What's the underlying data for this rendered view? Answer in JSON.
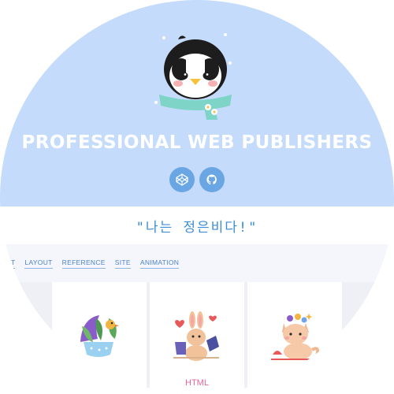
{
  "hero": {
    "title": "PROFESSIONAL WEB PUBLISHERS",
    "background_color": "#c4dbfb",
    "mascot_icon": "penguin-with-scarf-icon",
    "links": [
      {
        "name": "codepen-link",
        "icon": "codepen-icon"
      },
      {
        "name": "github-link",
        "icon": "github-icon"
      }
    ]
  },
  "quote": "\"나는 정은비다!\"",
  "nav": {
    "items": [
      "PT",
      "LAYOUT",
      "REFERENCE",
      "SITE",
      "ANIMATION"
    ]
  },
  "cards": [
    {
      "icon": "plant-bird-illustration-icon",
      "label": ""
    },
    {
      "icon": "bunny-illustration-icon",
      "label": "HTML"
    },
    {
      "icon": "cat-illustration-icon",
      "label": ""
    }
  ],
  "colors": {
    "accent": "#3c8dd9",
    "button": "#6aa6e3",
    "label_pink": "#e2679a"
  }
}
